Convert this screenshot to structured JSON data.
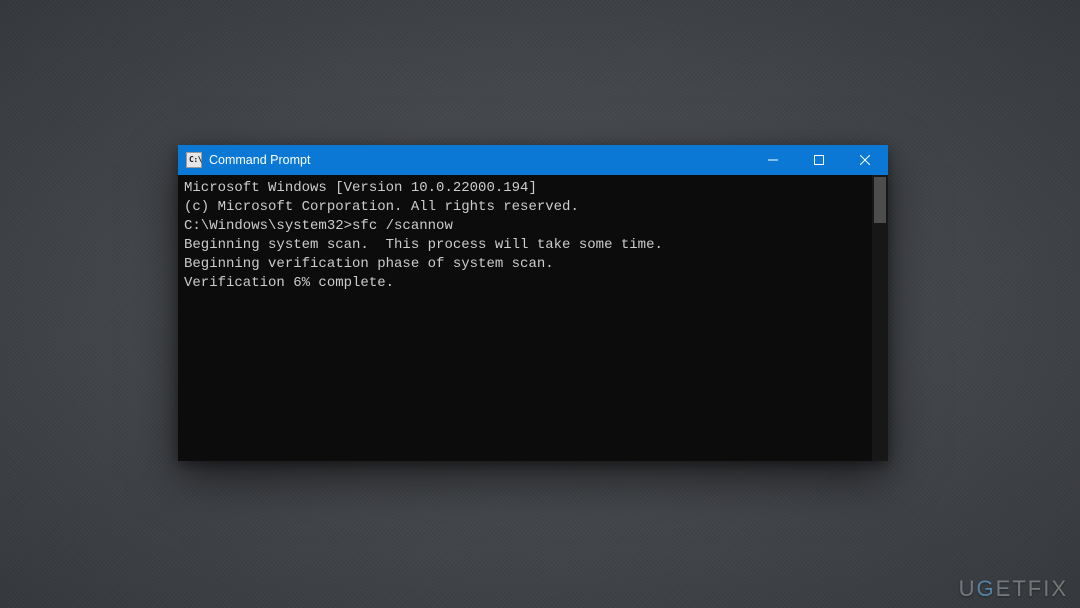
{
  "window": {
    "title": "Command Prompt",
    "icon_label": "C:\\"
  },
  "terminal": {
    "lines": [
      "Microsoft Windows [Version 10.0.22000.194]",
      "(c) Microsoft Corporation. All rights reserved.",
      "",
      "C:\\Windows\\system32>sfc /scannow",
      "",
      "Beginning system scan.  This process will take some time.",
      "",
      "Beginning verification phase of system scan.",
      "Verification 6% complete."
    ],
    "prompt_path": "C:\\Windows\\system32>",
    "command": "sfc /scannow",
    "progress_percent": 6
  },
  "watermark": {
    "prefix": "U",
    "accent": "G",
    "mid": "ETFI",
    "suffix": "X"
  }
}
